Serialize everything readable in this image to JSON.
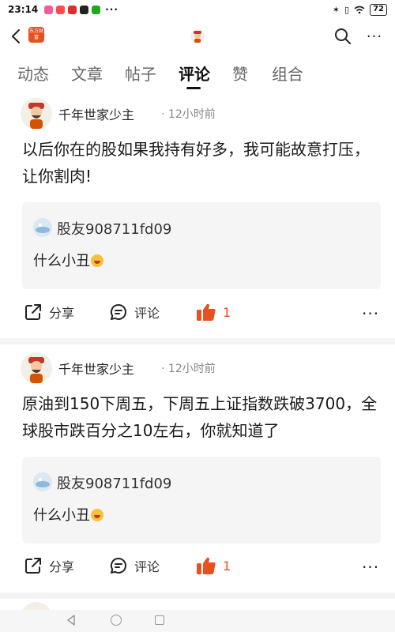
{
  "status_bar": {
    "time": "23:14",
    "battery": "72",
    "app_icon_colors": [
      "#f55a9a",
      "#ff4d4f",
      "#e22d2d",
      "#222222",
      "#1aad19"
    ]
  },
  "top_bar": {
    "logo_text": "东方财富",
    "back_icon": "chevron-left-icon",
    "search_icon": "search-icon",
    "more_icon": "more-horizontal-icon"
  },
  "tabs": [
    "动态",
    "文章",
    "帖子",
    "评论",
    "赞",
    "组合"
  ],
  "active_tab": "评论",
  "posts": [
    {
      "author": "千年世家少主",
      "time_ago": "12小时前",
      "text": "以后你在的股如果我持有好多，我可能故意打压，让你割肉!",
      "quote_user": "股友908711fd09",
      "quote_text": "什么小丑",
      "share_label": "分享",
      "comment_label": "评论",
      "like_count": "1"
    },
    {
      "author": "千年世家少主",
      "time_ago": "12小时前",
      "text": "原油到150下周五，下周五上证指数跌破3700，全球股市跌百分之10左右，你就知道了",
      "quote_user": "股友908711fd09",
      "quote_text": "什么小丑",
      "share_label": "分享",
      "comment_label": "评论",
      "like_count": "1"
    }
  ],
  "colors": {
    "accent": "#e8501f",
    "quote_bg": "#f5f5f5",
    "divider": "#f4f4f4"
  }
}
